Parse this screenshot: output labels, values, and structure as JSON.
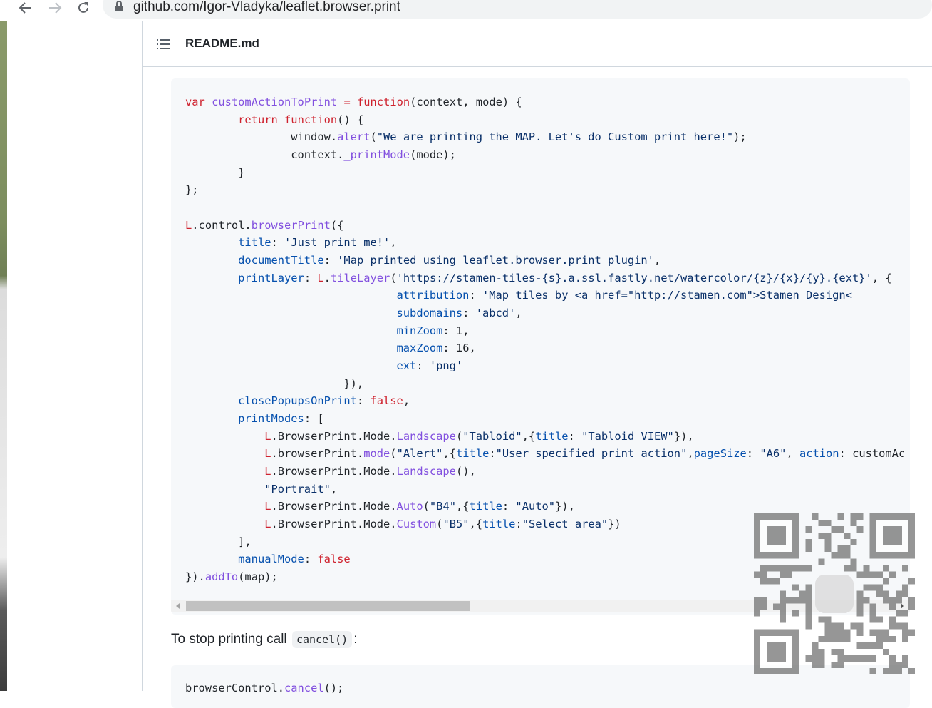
{
  "browser": {
    "url": "github.com/Igor-Vladyka/leaflet.browser.print"
  },
  "readme": {
    "title": "README.md"
  },
  "code_lines": [
    "var customActionToPrint = function(context, mode) {",
    "        return function() {",
    "                window.alert(\"We are printing the MAP. Let's do Custom print here!\");",
    "                context._printMode(mode);",
    "        }",
    "};",
    "",
    "L.control.browserPrint({",
    "        title: 'Just print me!',",
    "        documentTitle: 'Map printed using leaflet.browser.print plugin',",
    "        printLayer: L.tileLayer('https://stamen-tiles-{s}.a.ssl.fastly.net/watercolor/{z}/{x}/{y}.{ext}', {",
    "                                attribution: 'Map tiles by <a href=\"http://stamen.com\">Stamen Design<",
    "                                subdomains: 'abcd',",
    "                                minZoom: 1,",
    "                                maxZoom: 16,",
    "                                ext: 'png'",
    "                        }),",
    "        closePopupsOnPrint: false,",
    "        printModes: [",
    "            L.BrowserPrint.Mode.Landscape(\"Tabloid\",{title: \"Tabloid VIEW\"}),",
    "            L.browserPrint.mode(\"Alert\",{title:\"User specified print action\",pageSize: \"A6\", action: customAc",
    "            L.BrowserPrint.Mode.Landscape(),",
    "            \"Portrait\",",
    "            L.BrowserPrint.Mode.Auto(\"B4\",{title: \"Auto\"}),",
    "            L.BrowserPrint.Mode.Custom(\"B5\",{title:\"Select area\"})",
    "        ],",
    "        manualMode: false",
    "}).addTo(map);"
  ],
  "paragraph": {
    "text": "To stop printing call",
    "code": "cancel()",
    "suffix": ":"
  },
  "code2_line": "browserControl.cancel();",
  "colors": {
    "keyword": "#cf222e",
    "function": "#8250df",
    "property": "#0550ae",
    "string": "#0a3069",
    "code_bg": "#f6f8fa"
  },
  "icons": [
    "back-arrow-icon",
    "forward-arrow-icon",
    "reload-icon",
    "lock-icon",
    "list-icon",
    "qr-code-icon"
  ]
}
